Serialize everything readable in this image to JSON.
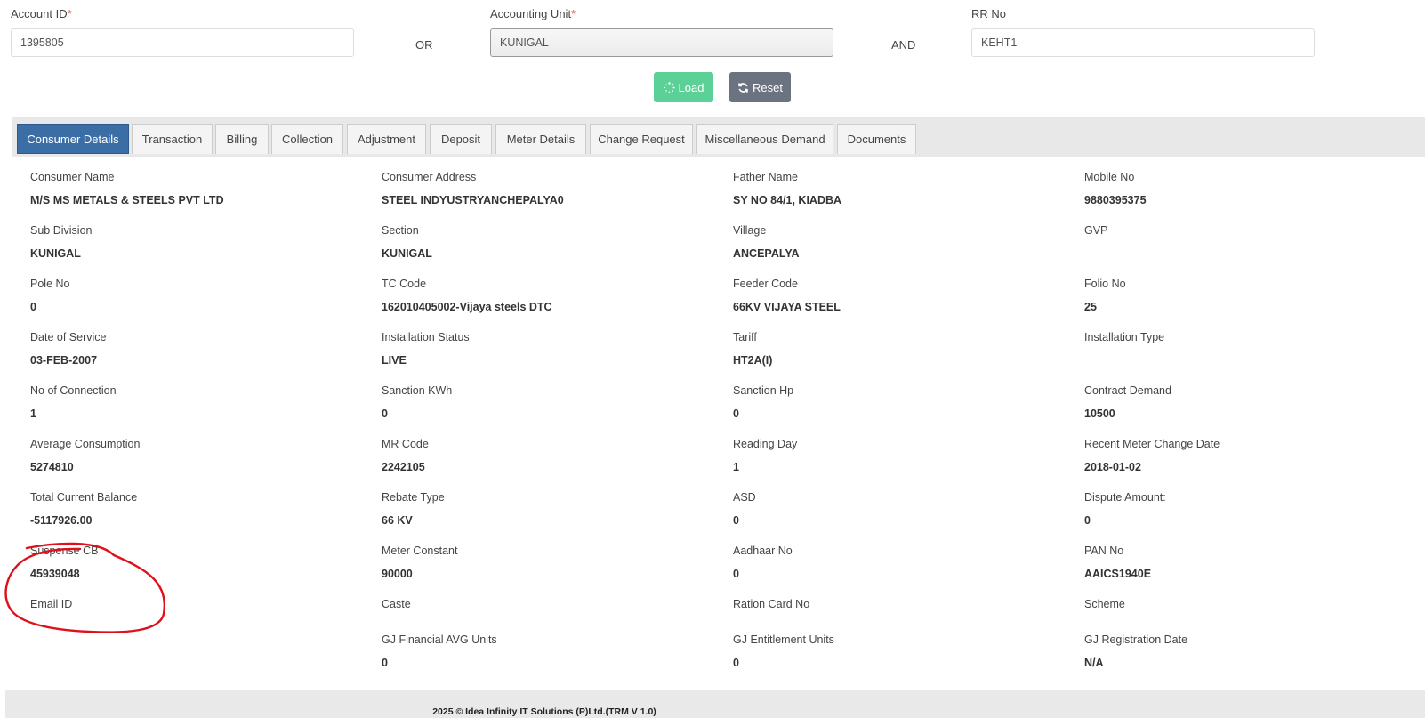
{
  "search": {
    "account_id": {
      "label": "Account ID",
      "required_mark": "*",
      "value": "1395805"
    },
    "or_text": "OR",
    "accounting_unit": {
      "label": "Accounting Unit",
      "required_mark": "*",
      "value": "KUNIGAL"
    },
    "and_text": "AND",
    "rr_no": {
      "label": "RR No",
      "value": "KEHT1"
    },
    "load_label": "Load",
    "reset_label": "Reset"
  },
  "tabs": [
    {
      "label": "Consumer Details",
      "active": true
    },
    {
      "label": "Transaction"
    },
    {
      "label": "Billing"
    },
    {
      "label": "Collection"
    },
    {
      "label": "Adjustment"
    },
    {
      "label": "Deposit"
    },
    {
      "label": "Meter Details"
    },
    {
      "label": "Change Request"
    },
    {
      "label": "Miscellaneous Demand"
    },
    {
      "label": "Documents"
    }
  ],
  "details": [
    {
      "label": "Consumer Name",
      "value": "M/S MS METALS & STEELS PVT LTD"
    },
    {
      "label": "Consumer Address",
      "value": "STEEL INDYUSTRYANCHEPALYA0"
    },
    {
      "label": "Father Name",
      "value": "SY NO 84/1, KIADBA"
    },
    {
      "label": "Mobile No",
      "value": "9880395375"
    },
    {
      "label": "Sub Division",
      "value": "KUNIGAL"
    },
    {
      "label": "Section",
      "value": "KUNIGAL"
    },
    {
      "label": "Village",
      "value": "ANCEPALYA"
    },
    {
      "label": "GVP",
      "value": ""
    },
    {
      "label": "Pole No",
      "value": "0"
    },
    {
      "label": "TC Code",
      "value": "162010405002-Vijaya steels DTC"
    },
    {
      "label": "Feeder Code",
      "value": "66KV VIJAYA STEEL"
    },
    {
      "label": "Folio No",
      "value": "25"
    },
    {
      "label": "Date of Service",
      "value": "03-FEB-2007"
    },
    {
      "label": "Installation Status",
      "value": "LIVE"
    },
    {
      "label": "Tariff",
      "value": "HT2A(I)"
    },
    {
      "label": "Installation Type",
      "value": ""
    },
    {
      "label": "No of Connection",
      "value": "1"
    },
    {
      "label": "Sanction KWh",
      "value": "0"
    },
    {
      "label": "Sanction Hp",
      "value": "0"
    },
    {
      "label": "Contract Demand",
      "value": "10500"
    },
    {
      "label": "Average Consumption",
      "value": "5274810"
    },
    {
      "label": "MR Code",
      "value": "2242105"
    },
    {
      "label": "Reading Day",
      "value": "1"
    },
    {
      "label": "Recent Meter Change Date",
      "value": "2018-01-02"
    },
    {
      "label": "Total Current Balance",
      "value": "-5117926.00"
    },
    {
      "label": "Rebate Type",
      "value": "66 KV"
    },
    {
      "label": "ASD",
      "value": "0"
    },
    {
      "label": "Dispute Amount:",
      "value": "0"
    },
    {
      "label": "Suspense CB",
      "value": "45939048"
    },
    {
      "label": "Meter Constant",
      "value": "90000"
    },
    {
      "label": "Aadhaar No",
      "value": "0"
    },
    {
      "label": "PAN No",
      "value": "AAICS1940E"
    },
    {
      "label": "Email ID",
      "value": ""
    },
    {
      "label": "Caste",
      "value": ""
    },
    {
      "label": "Ration Card No",
      "value": ""
    },
    {
      "label": "Scheme",
      "value": ""
    },
    {
      "label": "",
      "value": ""
    },
    {
      "label": "GJ Financial AVG Units",
      "value": "0"
    },
    {
      "label": "GJ Entitlement Units",
      "value": "0"
    },
    {
      "label": "GJ Registration Date",
      "value": "N/A"
    }
  ],
  "footer": {
    "text": "2025 © Idea Infinity IT Solutions (P)Ltd.(TRM V 1.0)"
  },
  "icons": {
    "load": "spinner-icon",
    "reset": "refresh-icon"
  },
  "colors": {
    "load": "#5cd197",
    "reset": "#6b7280",
    "active_tab": "#3c6ea6",
    "annotation": "#e0101a"
  }
}
